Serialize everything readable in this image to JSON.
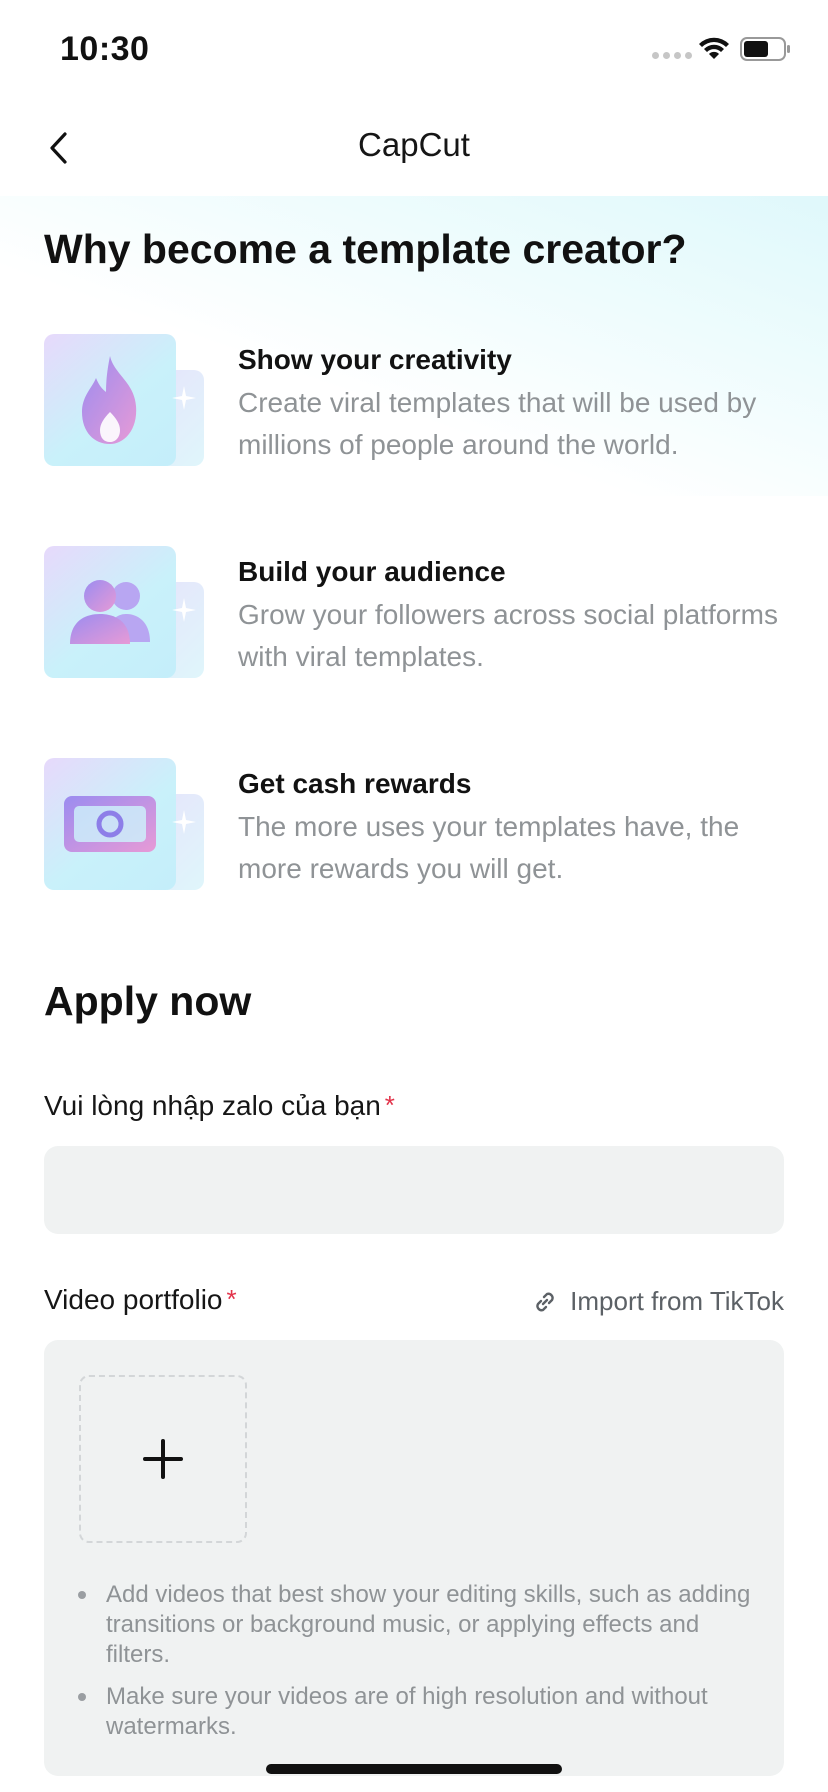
{
  "status_bar": {
    "time": "10:30"
  },
  "nav": {
    "title": "CapCut"
  },
  "intro": {
    "title": "Why become a template creator?"
  },
  "benefits": [
    {
      "icon": "flame-icon",
      "title": "Show your creativity",
      "desc": "Create viral templates that will be used by millions of people around the world."
    },
    {
      "icon": "people-icon",
      "title": "Build your audience",
      "desc": "Grow your followers across social platforms with viral templates."
    },
    {
      "icon": "cash-icon",
      "title": "Get cash rewards",
      "desc": "The more uses your templates have, the more rewards you will get."
    }
  ],
  "apply": {
    "title": "Apply now",
    "zalo_label": "Vui lòng nhập zalo của bạn",
    "required_mark": "*",
    "zalo_value": "",
    "portfolio_label": "Video portfolio",
    "import_label": "Import from TikTok",
    "add_symbol": "+",
    "tips": [
      "Add videos that best show your editing skills, such as adding transitions or background music, or applying effects and filters.",
      "Make sure your videos are of high resolution and without watermarks."
    ]
  },
  "colors": {
    "required": "#e2334a",
    "muted_text": "#8f9396",
    "input_bg": "#f0f2f2",
    "accent_gradient_start": "#e7d9fb",
    "accent_gradient_end": "#c4eefa"
  }
}
